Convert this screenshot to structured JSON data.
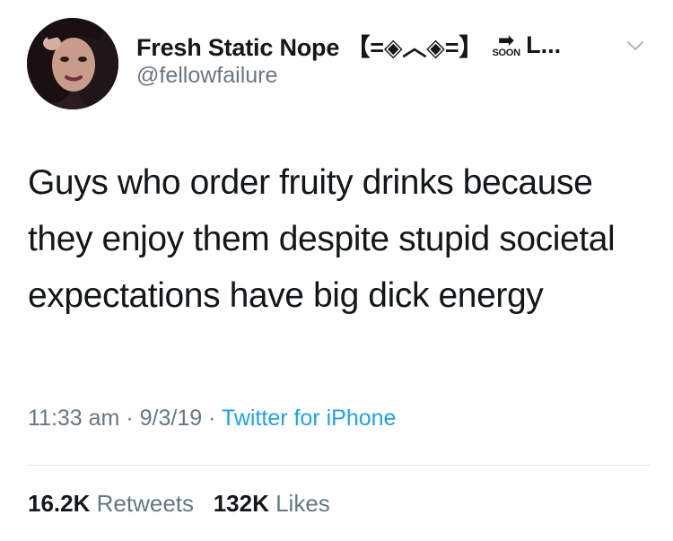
{
  "author": {
    "display_name": "Fresh Static Nope 【=◈︿◈=】",
    "soon_icon_label": "SOON",
    "name_suffix": "L...",
    "handle": "@fellowfailure",
    "avatar_icon": "profile-photo"
  },
  "tweet": {
    "text": "Guys who order fruity drinks because they enjoy them despite stupid societal expectations have big dick energy",
    "time": "11:33 am",
    "date": "9/3/19",
    "separator": "·",
    "source": "Twitter for iPhone"
  },
  "stats": {
    "retweets_count": "16.2K",
    "retweets_label": "Retweets",
    "likes_count": "132K",
    "likes_label": "Likes"
  },
  "colors": {
    "text": "#14171a",
    "secondary": "#657786",
    "link": "#1da1f2",
    "divider": "#e1e8ed"
  }
}
